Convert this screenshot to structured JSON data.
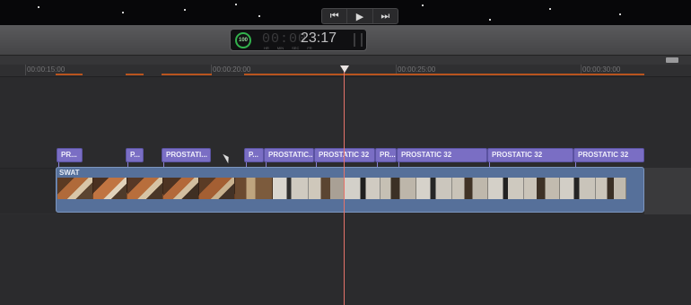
{
  "transport": {
    "prev_icon": "skip-back-icon",
    "prev_glyph": "⏮",
    "play_icon": "play-icon",
    "play_glyph": "▶",
    "next_icon": "skip-forward-icon",
    "next_glyph": "⏭"
  },
  "timecode": {
    "badge": "100",
    "hidden_digits": "00:00",
    "value": "23:17",
    "units": [
      "HR",
      "MIN",
      "SEC",
      "FR"
    ],
    "badge_color": "#32b24c"
  },
  "ruler": {
    "ticks": [
      "00:00:15:00",
      "00:00:20:00",
      "00:00:25:00",
      "00:00:30:00"
    ]
  },
  "connected_clips": [
    {
      "label": "PR..."
    },
    {
      "label": "P..."
    },
    {
      "label": "PROSTATI..."
    },
    {
      "label": "P..."
    },
    {
      "label": "PROSTATIC..."
    },
    {
      "label": "PROSTATIC 32"
    },
    {
      "label": "PR..."
    },
    {
      "label": "PROSTATIC 32"
    },
    {
      "label": "PROSTATIC 32"
    },
    {
      "label": "PROSTATIC 32"
    }
  ],
  "storyline": {
    "label": "SWAT"
  },
  "colors": {
    "connected_clip": "#7a6ec4",
    "storyline": "#56709a",
    "playhead": "#e5736a",
    "ruler_mark": "#b9541e"
  }
}
